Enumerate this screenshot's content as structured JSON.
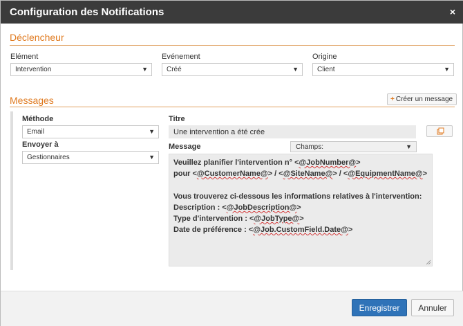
{
  "dialog": {
    "title": "Configuration des Notifications",
    "close_glyph": "×"
  },
  "trigger": {
    "section_title": "Déclencheur",
    "element": {
      "label": "Elément",
      "value": "Intervention"
    },
    "event": {
      "label": "Evénement",
      "value": "Créé"
    },
    "origin": {
      "label": "Origine",
      "value": "Client"
    }
  },
  "messages": {
    "section_title": "Messages",
    "create_button": "Créer un message",
    "method": {
      "label": "Méthode",
      "value": "Email"
    },
    "send_to": {
      "label": "Envoyer à",
      "value": "Gestionnaires"
    },
    "title_field": {
      "label": "Titre",
      "value": "Une intervention a été crée"
    },
    "message_field": {
      "label": "Message",
      "fields_dropdown": "Champs:",
      "lines": [
        [
          "Veuillez planifier l'intervention n° <",
          "@JobNumber@",
          ">"
        ],
        [
          "pour <",
          "@CustomerName@",
          "> / <",
          "@SiteName@",
          "> / <",
          "@EquipmentName@",
          ">"
        ],
        [
          ""
        ],
        [
          "Vous trouverez ci-dessous les informations relatives à l'intervention:"
        ],
        [
          "Description : <",
          "@JobDescription@",
          ">"
        ],
        [
          "Type d'intervention : <",
          "@JobType@",
          ">"
        ],
        [
          "Date de préférence : <",
          "@Job.CustomField.Date@",
          ">"
        ]
      ]
    }
  },
  "footer": {
    "save_label": "Enregistrer",
    "cancel_label": "Annuler"
  },
  "colors": {
    "accent": "#e07a1f",
    "primary": "#2f73b8",
    "titlebar": "#3b3b3b"
  },
  "icons": [
    "close-icon",
    "plus-icon",
    "dropdown-arrow-icon",
    "copy-icon",
    "resize-handle-icon"
  ]
}
